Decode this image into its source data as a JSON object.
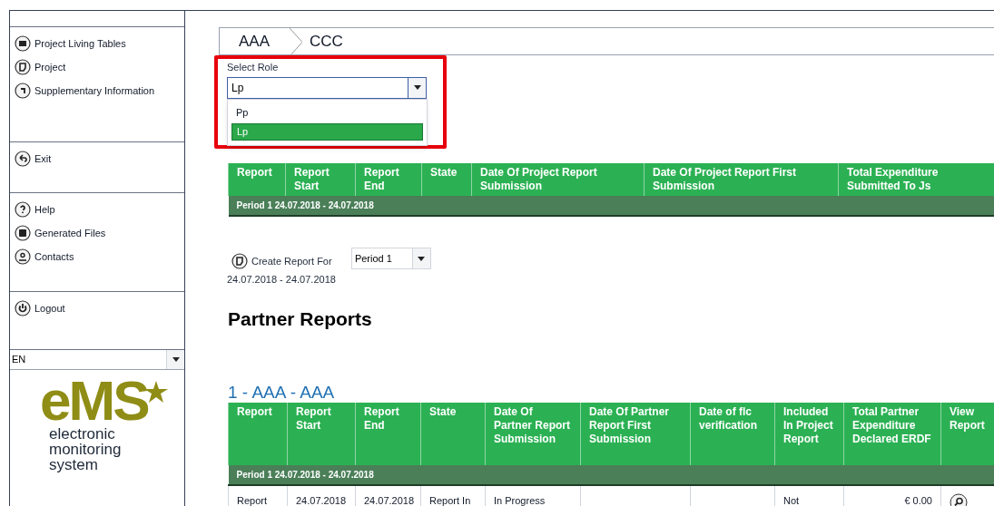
{
  "sidebar": {
    "groups": [
      {
        "items": [
          {
            "label": "Project Living Tables"
          },
          {
            "label": "Project"
          },
          {
            "label": "Supplementary Information"
          }
        ]
      },
      {
        "items": [
          {
            "label": "Exit"
          }
        ]
      },
      {
        "items": [
          {
            "label": "Help"
          },
          {
            "label": "Generated Files"
          },
          {
            "label": "Contacts"
          }
        ]
      },
      {
        "items": [
          {
            "label": "Logout"
          }
        ]
      }
    ],
    "language": {
      "value": "EN"
    },
    "logo": {
      "mark": "eMS",
      "tagline": "electronic monitoring system"
    }
  },
  "breadcrumb": [
    "AAA",
    "CCC"
  ],
  "role_select": {
    "label": "Select Role",
    "value": "Lp",
    "options": [
      {
        "label": "Pp",
        "selected": false
      },
      {
        "label": "Lp",
        "selected": true
      }
    ]
  },
  "project_reports": {
    "columns": [
      "Report",
      "Report Start",
      "Report End",
      "State",
      "Date Of Project Report Submission",
      "Date Of Project Report First Submission",
      "Total Expenditure Submitted To Js"
    ],
    "period": "Period 1 24.07.2018 - 24.07.2018"
  },
  "create_report": {
    "label": "Create Report For",
    "range": "24.07.2018 - 24.07.2018",
    "period": "Period 1"
  },
  "partner_reports": {
    "title": "Partner Reports",
    "partner": "1 - AAA - AAA",
    "columns": [
      "Report",
      "Report Start",
      "Report End",
      "State",
      "Date Of Partner Report Submission",
      "Date Of Partner Report First Submission",
      "Date of flc verification",
      "Included In Project Report",
      "Total Partner Expenditure Declared ERDF",
      "View Report"
    ],
    "period": "Period 1 24.07.2018 - 24.07.2018",
    "rows": [
      [
        "Report",
        "24.07.2018",
        "24.07.2018",
        "Report In",
        "In Progress",
        "",
        "",
        "Not",
        "€ 0.00",
        ""
      ]
    ]
  }
}
